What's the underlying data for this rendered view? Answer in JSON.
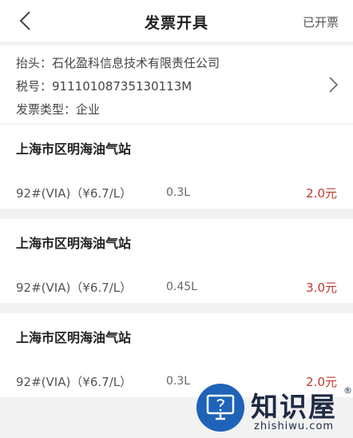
{
  "header": {
    "title": "发票开具",
    "right_link": "已开票"
  },
  "invoice": {
    "title_label": "抬头：",
    "title_value": "石化盈科信息技术有限责任公司",
    "tax_label": "税号：",
    "tax_value": "91110108735130113M",
    "type_label": "发票类型：",
    "type_value": "企业"
  },
  "orders": [
    {
      "station": "上海市区明海油气站",
      "fuel": "92#(VIA)（¥6.7/L）",
      "volume": "0.3L",
      "amount": "2.0元"
    },
    {
      "station": "上海市区明海油气站",
      "fuel": "92#(VIA)（¥6.7/L）",
      "volume": "0.45L",
      "amount": "3.0元"
    },
    {
      "station": "上海市区明海油气站",
      "fuel": "92#(VIA)（¥6.7/L）",
      "volume": "0.3L",
      "amount": "2.0元"
    }
  ],
  "watermark": {
    "brand": "知识屋",
    "reg_mark": "®",
    "url": "zhishiwu.com"
  },
  "colors": {
    "amount": "#c0392b",
    "watermark_blue": "#1e63b8"
  }
}
